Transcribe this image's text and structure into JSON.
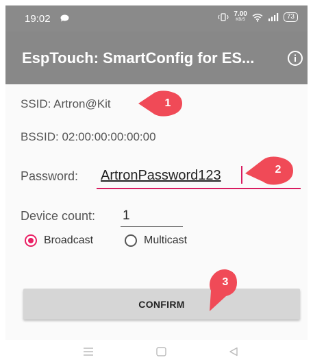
{
  "status_bar": {
    "time": "19:02",
    "net_speed_value": "7.00",
    "net_speed_unit": "KB/S",
    "battery": "73"
  },
  "app_bar": {
    "title": "EspTouch: SmartConfig for ES..."
  },
  "form": {
    "ssid": "SSID: Artron@Kit",
    "bssid": "BSSID: 02:00:00:00:00:00",
    "password_label": "Password:",
    "password_value": "ArtronPassword123",
    "device_count_label": "Device count:",
    "device_count_value": "1",
    "broadcast_label": "Broadcast",
    "multicast_label": "Multicast",
    "selected_mode": "Broadcast"
  },
  "confirm_label": "CONFIRM",
  "callouts": [
    "1",
    "2",
    "3"
  ],
  "colors": {
    "app_bar": "#888888",
    "accent": "#e91e63",
    "callout": "#f04a57",
    "button": "#d6d6d6"
  },
  "icons": {
    "info": "info-circle-icon",
    "nav_menu": "menu-icon",
    "nav_home": "home-icon",
    "nav_back": "back-icon"
  }
}
